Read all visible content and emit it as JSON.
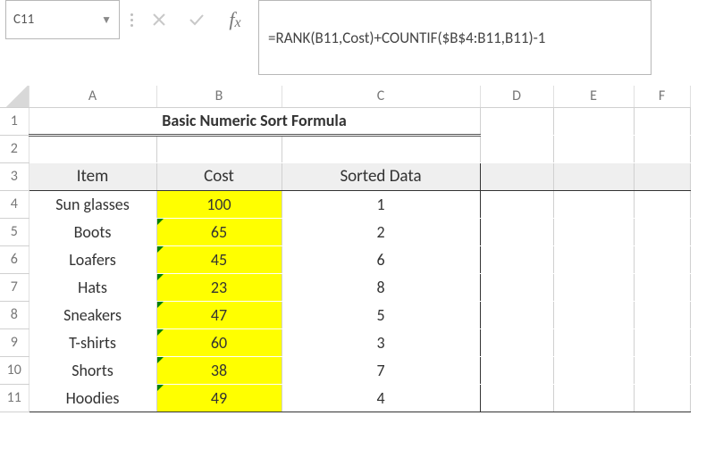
{
  "app": {
    "nameBox": "C11",
    "formula": "=RANK(B11,Cost)+COUNTIF($B$4:B11,B11)-1"
  },
  "columns": [
    "A",
    "B",
    "C",
    "D",
    "E",
    "F"
  ],
  "rows": [
    "1",
    "2",
    "3",
    "4",
    "5",
    "6",
    "7",
    "8",
    "9",
    "10",
    "11"
  ],
  "title": "Basic Numeric Sort Formula",
  "headers": {
    "item": "Item",
    "cost": "Cost",
    "sorted": "Sorted Data"
  },
  "table": [
    {
      "item": "Sun glasses",
      "cost": "100",
      "sorted": "1",
      "err": false
    },
    {
      "item": "Boots",
      "cost": "65",
      "sorted": "2",
      "err": true
    },
    {
      "item": "Loafers",
      "cost": "45",
      "sorted": "6",
      "err": true
    },
    {
      "item": "Hats",
      "cost": "23",
      "sorted": "8",
      "err": true
    },
    {
      "item": "Sneakers",
      "cost": "47",
      "sorted": "5",
      "err": true
    },
    {
      "item": "T-shirts",
      "cost": "60",
      "sorted": "3",
      "err": true
    },
    {
      "item": "Shorts",
      "cost": "38",
      "sorted": "7",
      "err": true
    },
    {
      "item": "Hoodies",
      "cost": "49",
      "sorted": "4",
      "err": true
    }
  ],
  "chart_data": {
    "type": "table",
    "title": "Basic Numeric Sort Formula",
    "columns": [
      "Item",
      "Cost",
      "Sorted Data"
    ],
    "rows": [
      [
        "Sun glasses",
        100,
        1
      ],
      [
        "Boots",
        65,
        2
      ],
      [
        "Loafers",
        45,
        6
      ],
      [
        "Hats",
        23,
        8
      ],
      [
        "Sneakers",
        47,
        5
      ],
      [
        "T-shirts",
        60,
        3
      ],
      [
        "Shorts",
        38,
        7
      ],
      [
        "Hoodies",
        49,
        4
      ]
    ]
  }
}
